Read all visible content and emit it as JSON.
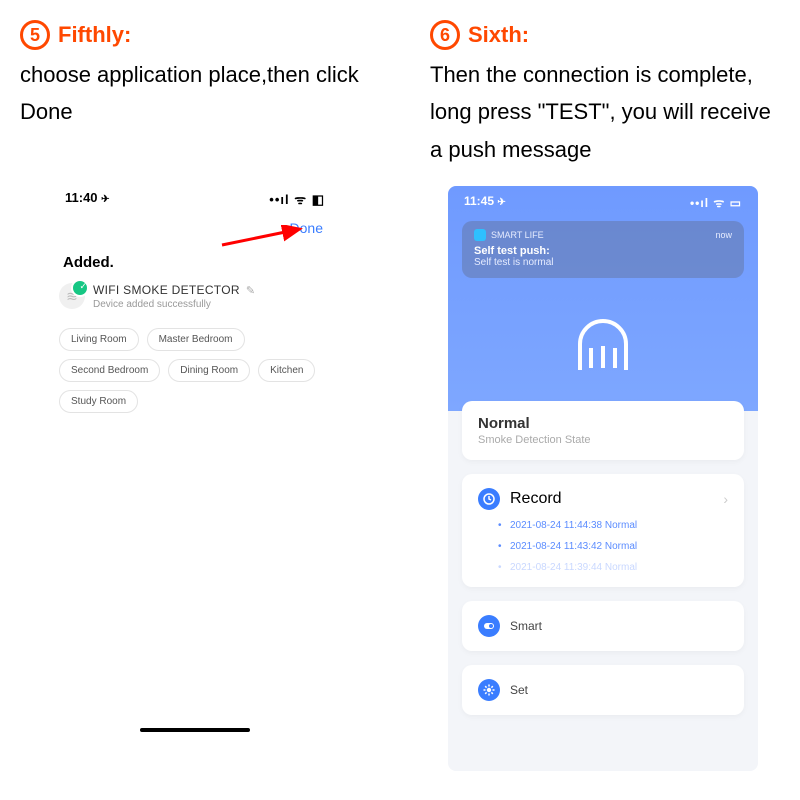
{
  "step5": {
    "num": "5",
    "label": "Fifthly:",
    "instr": "choose application place,then click Done"
  },
  "step6": {
    "num": "6",
    "label": "Sixth:",
    "instr": "Then the connection is complete, long press \"TEST\", you will receive a push message"
  },
  "left": {
    "time": "11:40",
    "done": "Done",
    "added": "Added.",
    "device_name": "WIFI  SMOKE DETECTOR",
    "device_sub": "Device added successfully",
    "rooms": [
      "Living Room",
      "Master Bedroom",
      "Second Bedroom",
      "Dining Room",
      "Kitchen",
      "Study Room"
    ]
  },
  "right": {
    "time": "11:45",
    "notif_app": "SMART LIFE",
    "notif_when": "now",
    "notif_title": "Self test push:",
    "notif_body": "Self test is normal",
    "state_title": "Normal",
    "state_sub": "Smoke Detection State",
    "record_label": "Record",
    "records": [
      "2021-08-24 11:44:38 Normal",
      "2021-08-24 11:43:42 Normal",
      "2021-08-24 11:39:44 Normal"
    ],
    "smart_label": "Smart",
    "set_label": "Set"
  }
}
